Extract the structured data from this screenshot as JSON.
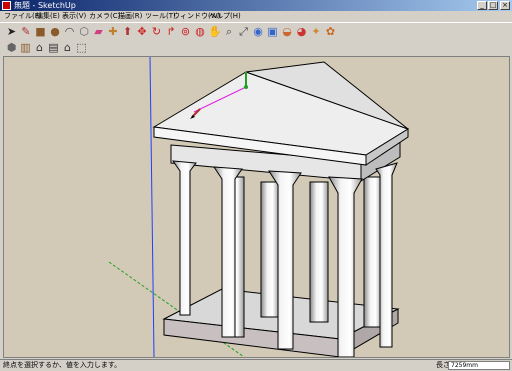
{
  "window": {
    "title": "無題 - SketchUp",
    "min": "_",
    "max": "□",
    "close": "×"
  },
  "menu": [
    "ファイル(F)",
    "編集(E)",
    "表示(V)",
    "カメラ(C)",
    "描画(R)",
    "ツール(T)",
    "ウィンドウ(W)",
    "ヘルプ(H)"
  ],
  "toolbar1": [
    {
      "icon": "select-arrow-icon",
      "glyph": "➤",
      "color": "#222222"
    },
    {
      "icon": "pencil-icon",
      "glyph": "✎",
      "color": "#b03030"
    },
    {
      "icon": "rectangle-icon",
      "glyph": "■",
      "color": "#8b5a2b"
    },
    {
      "icon": "circle-icon",
      "glyph": "●",
      "color": "#8b5a2b"
    },
    {
      "icon": "arc-icon",
      "glyph": "◠",
      "color": "#444444"
    },
    {
      "icon": "make-component-icon",
      "glyph": "⬡",
      "color": "#666666"
    },
    {
      "icon": "eraser-icon",
      "glyph": "▰",
      "color": "#d04080"
    },
    {
      "icon": "paint-bucket-icon",
      "glyph": "✚",
      "color": "#c08030"
    },
    {
      "icon": "push-pull-icon",
      "glyph": "⬆",
      "color": "#aa3333"
    },
    {
      "icon": "move-icon",
      "glyph": "✥",
      "color": "#cc2222"
    },
    {
      "icon": "rotate-icon",
      "glyph": "↻",
      "color": "#cc2222"
    },
    {
      "icon": "follow-me-icon",
      "glyph": "↱",
      "color": "#cc2222"
    },
    {
      "icon": "offset-icon",
      "glyph": "⊚",
      "color": "#cc2222"
    },
    {
      "icon": "orbit-icon",
      "glyph": "◍",
      "color": "#cc2222"
    },
    {
      "icon": "pan-hand-icon",
      "glyph": "✋",
      "color": "#555555"
    },
    {
      "icon": "zoom-icon",
      "glyph": "⌕",
      "color": "#444444"
    },
    {
      "icon": "zoom-extents-icon",
      "glyph": "⤢",
      "color": "#444444"
    },
    {
      "icon": "get-models-icon",
      "glyph": "◉",
      "color": "#3366cc"
    },
    {
      "icon": "share-model-icon",
      "glyph": "▣",
      "color": "#3366cc"
    },
    {
      "icon": "send-to-layout-icon",
      "glyph": "◒",
      "color": "#cc6633"
    },
    {
      "icon": "get-photo-texture-icon",
      "glyph": "◕",
      "color": "#cc3333"
    },
    {
      "icon": "components-icon",
      "glyph": "✦",
      "color": "#cc8833"
    },
    {
      "icon": "extension-icon",
      "glyph": "✿",
      "color": "#cc6622"
    }
  ],
  "toolbar2": [
    {
      "icon": "iso-view-icon",
      "glyph": "⬢",
      "color": "#666666"
    },
    {
      "icon": "top-view-icon",
      "glyph": "▥",
      "color": "#8b5a2b"
    },
    {
      "icon": "front-view-icon",
      "glyph": "⌂",
      "color": "#333333"
    },
    {
      "icon": "right-view-icon",
      "glyph": "▤",
      "color": "#333333"
    },
    {
      "icon": "back-view-icon",
      "glyph": "⌂",
      "color": "#333333"
    },
    {
      "icon": "left-view-icon",
      "glyph": "⬚",
      "color": "#333333"
    }
  ],
  "status": {
    "hint": "終点を選択するか、値を入力します。",
    "vcb_label": "長さ",
    "vcb_value": "7259mm"
  },
  "colors": {
    "sky": "#ffffff",
    "ground": "#d2c9b6",
    "axis_blue": "#2040ff",
    "axis_green": "#20a020",
    "magenta": "#e020e0",
    "base": "#d8d8d8",
    "base_side": "#c89090"
  }
}
